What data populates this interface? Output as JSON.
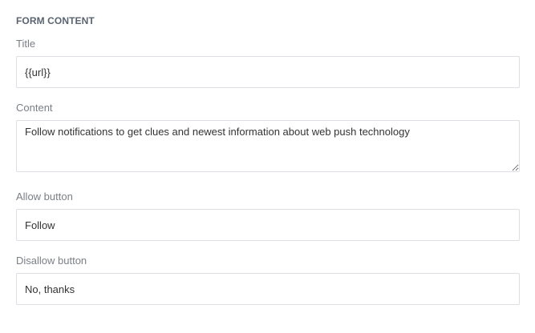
{
  "form": {
    "section_title": "FORM CONTENT",
    "fields": {
      "title": {
        "label": "Title",
        "value": "{{url}}"
      },
      "content": {
        "label": "Content",
        "value": "Follow notifications to get clues and newest information about web push technology"
      },
      "allow_button": {
        "label": "Allow button",
        "value": "Follow"
      },
      "disallow_button": {
        "label": "Disallow button",
        "value": "No, thanks"
      }
    }
  }
}
